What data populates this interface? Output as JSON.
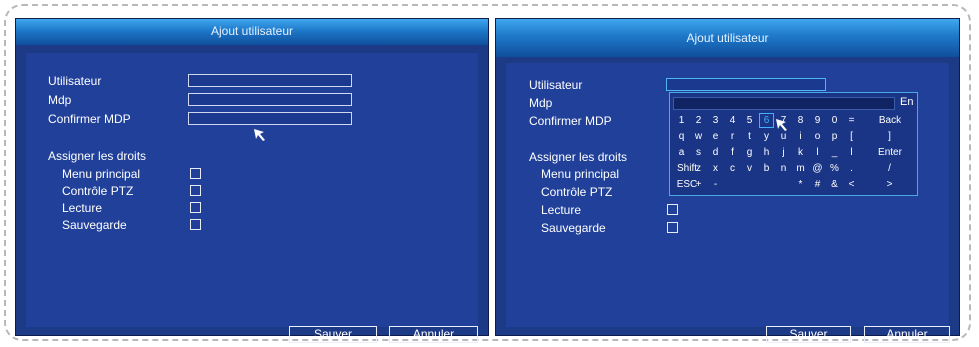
{
  "left": {
    "title": "Ajout utilisateur",
    "fields": [
      {
        "label": "Utilisateur",
        "value": ""
      },
      {
        "label": "Mdp",
        "value": ""
      },
      {
        "label": "Confirmer MDP",
        "value": ""
      }
    ],
    "rights_heading": "Assigner les droits",
    "rights": [
      {
        "label": "Menu principal",
        "checked": false
      },
      {
        "label": "Contrôle PTZ",
        "checked": false
      },
      {
        "label": "Lecture",
        "checked": false
      },
      {
        "label": "Sauvegarde",
        "checked": false
      }
    ],
    "save_label": "Sauver",
    "cancel_label": "Annuler"
  },
  "right": {
    "title": "Ajout utilisateur",
    "fields": [
      {
        "label": "Utilisateur",
        "value": ""
      },
      {
        "label": "Mdp",
        "value": ""
      },
      {
        "label": "Confirmer MDP",
        "value": ""
      }
    ],
    "rights_heading": "Assigner les droits",
    "rights": [
      {
        "label": "Menu principal",
        "checked": false
      },
      {
        "label": "Contrôle PTZ",
        "checked": false
      },
      {
        "label": "Lecture",
        "checked": false
      },
      {
        "label": "Sauvegarde",
        "checked": false
      }
    ],
    "save_label": "Sauver",
    "cancel_label": "Annuler",
    "keyboard": {
      "input_value": "",
      "language": "En",
      "highlighted_key": "6",
      "rows": [
        [
          "1",
          "2",
          "3",
          "4",
          "5",
          "6",
          "7",
          "8",
          "9",
          "0",
          "=",
          "Back"
        ],
        [
          "q",
          "w",
          "e",
          "r",
          "t",
          "y",
          "u",
          "i",
          "o",
          "p",
          "[",
          "]"
        ],
        [
          "a",
          "s",
          "d",
          "f",
          "g",
          "h",
          "j",
          "k",
          "l",
          "_",
          "l",
          "Enter"
        ],
        [
          "Shift",
          "z",
          "x",
          "c",
          "v",
          "b",
          "n",
          "m",
          "@",
          "%",
          ".",
          "/"
        ],
        [
          "ESC",
          "+",
          "-",
          "",
          "",
          "",
          "",
          "*",
          "#",
          "&",
          "<",
          ">"
        ]
      ]
    }
  },
  "colors": {
    "panel_bg": "#1d3a86",
    "titlebar": "#1e78c9",
    "highlight": "#3fb2ff"
  },
  "icons": {
    "cursor": "mouse-pointer-icon",
    "checkbox": "checkbox-icon"
  }
}
